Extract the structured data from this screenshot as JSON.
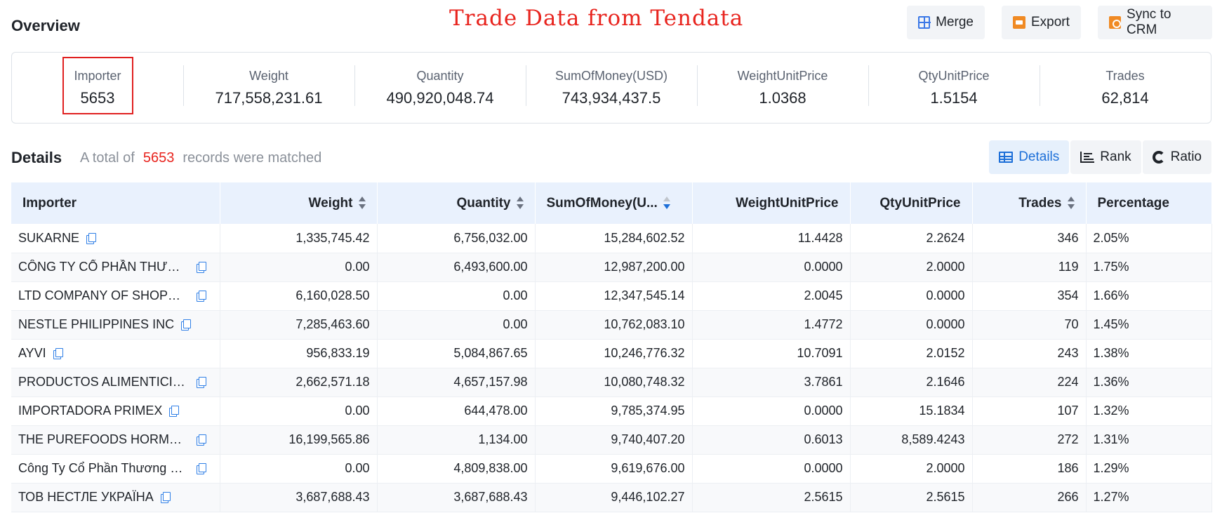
{
  "header": {
    "overview_title": "Overview",
    "watermark": "Trade Data from Tendata",
    "buttons": {
      "merge": "Merge",
      "export": "Export",
      "sync": "Sync to CRM"
    }
  },
  "stats": [
    {
      "label": "Importer",
      "value": "5653"
    },
    {
      "label": "Weight",
      "value": "717,558,231.61"
    },
    {
      "label": "Quantity",
      "value": "490,920,048.74"
    },
    {
      "label": "SumOfMoney(USD)",
      "value": "743,934,437.5"
    },
    {
      "label": "WeightUnitPrice",
      "value": "1.0368"
    },
    {
      "label": "QtyUnitPrice",
      "value": "1.5154"
    },
    {
      "label": "Trades",
      "value": "62,814"
    }
  ],
  "details": {
    "title": "Details",
    "prefix": "A total of",
    "count": "5653",
    "suffix": "records were matched",
    "tabs": {
      "details": "Details",
      "rank": "Rank",
      "ratio": "Ratio"
    }
  },
  "table": {
    "columns": {
      "importer": "Importer",
      "weight": "Weight",
      "quantity": "Quantity",
      "sum": "SumOfMoney(U...",
      "wup": "WeightUnitPrice",
      "qup": "QtyUnitPrice",
      "trades": "Trades",
      "percentage": "Percentage"
    },
    "rows": [
      {
        "importer": "SUKARNE",
        "weight": "1,335,745.42",
        "quantity": "6,756,032.00",
        "sum": "15,284,602.52",
        "wup": "11.4428",
        "qup": "2.2624",
        "trades": "346",
        "percentage": "2.05%"
      },
      {
        "importer": "CÔNG TY CỔ PHẦN THƯƠN...",
        "weight": "0.00",
        "quantity": "6,493,600.00",
        "sum": "12,987,200.00",
        "wup": "0.0000",
        "qup": "2.0000",
        "trades": "119",
        "percentage": "1.75%"
      },
      {
        "importer": "LTD COMPANY OF SHOPPIN...",
        "weight": "6,160,028.50",
        "quantity": "0.00",
        "sum": "12,347,545.14",
        "wup": "2.0045",
        "qup": "0.0000",
        "trades": "354",
        "percentage": "1.66%"
      },
      {
        "importer": "NESTLE PHILIPPINES INC",
        "weight": "7,285,463.60",
        "quantity": "0.00",
        "sum": "10,762,083.10",
        "wup": "1.4772",
        "qup": "0.0000",
        "trades": "70",
        "percentage": "1.45%"
      },
      {
        "importer": "AYVI",
        "weight": "956,833.19",
        "quantity": "5,084,867.65",
        "sum": "10,246,776.32",
        "wup": "10.7091",
        "qup": "2.0152",
        "trades": "243",
        "percentage": "1.38%"
      },
      {
        "importer": "PRODUCTOS ALIMENTICIOS...",
        "weight": "2,662,571.18",
        "quantity": "4,657,157.98",
        "sum": "10,080,748.32",
        "wup": "3.7861",
        "qup": "2.1646",
        "trades": "224",
        "percentage": "1.36%"
      },
      {
        "importer": "IMPORTADORA PRIMEX",
        "weight": "0.00",
        "quantity": "644,478.00",
        "sum": "9,785,374.95",
        "wup": "0.0000",
        "qup": "15.1834",
        "trades": "107",
        "percentage": "1.32%"
      },
      {
        "importer": "THE PUREFOODS HORMEL ...",
        "weight": "16,199,565.86",
        "quantity": "1,134.00",
        "sum": "9,740,407.20",
        "wup": "0.6013",
        "qup": "8,589.4243",
        "trades": "272",
        "percentage": "1.31%"
      },
      {
        "importer": "Công Ty Cổ Phần Thương M...",
        "weight": "0.00",
        "quantity": "4,809,838.00",
        "sum": "9,619,676.00",
        "wup": "0.0000",
        "qup": "2.0000",
        "trades": "186",
        "percentage": "1.29%"
      },
      {
        "importer": "ТОВ НЕСТЛЕ УКРАЇНА",
        "weight": "3,687,688.43",
        "quantity": "3,687,688.43",
        "sum": "9,446,102.27",
        "wup": "2.5615",
        "qup": "2.5615",
        "trades": "266",
        "percentage": "1.27%"
      }
    ]
  }
}
